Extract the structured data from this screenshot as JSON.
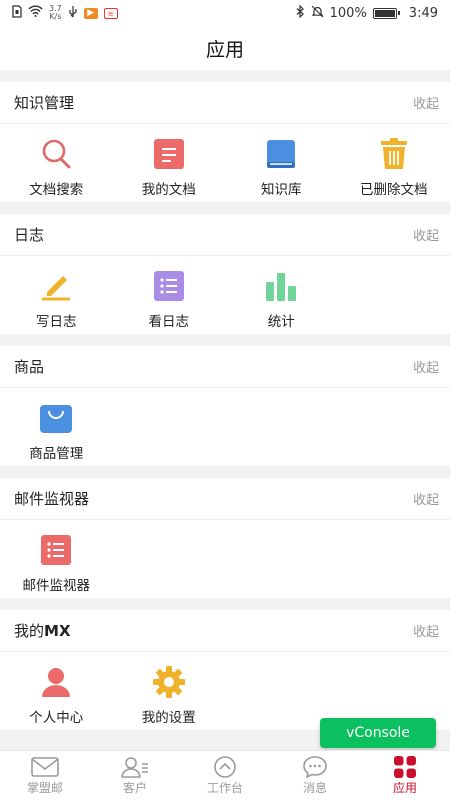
{
  "status_bar": {
    "speed": "3.7",
    "speed_unit": "K/s",
    "battery": "100%",
    "time": "3:49"
  },
  "header": {
    "title": "应用"
  },
  "sections": [
    {
      "title": "知识管理",
      "action": "收起",
      "items": [
        {
          "label": "文档搜索",
          "icon": "search-icon"
        },
        {
          "label": "我的文档",
          "icon": "document-icon"
        },
        {
          "label": "知识库",
          "icon": "book-icon"
        },
        {
          "label": "已删除文档",
          "icon": "trash-icon"
        }
      ]
    },
    {
      "title": "日志",
      "action": "收起",
      "items": [
        {
          "label": "写日志",
          "icon": "pencil-icon"
        },
        {
          "label": "看日志",
          "icon": "list-icon"
        },
        {
          "label": "统计",
          "icon": "bar-chart-icon"
        }
      ]
    },
    {
      "title": "商品",
      "action": "收起",
      "items": [
        {
          "label": "商品管理",
          "icon": "shopping-bag-icon"
        }
      ]
    },
    {
      "title": "邮件监视器",
      "action": "收起",
      "items": [
        {
          "label": "邮件监视器",
          "icon": "list-icon"
        }
      ]
    },
    {
      "title_prefix": "我的",
      "title_suffix": "MX",
      "action": "收起",
      "items": [
        {
          "label": "个人中心",
          "icon": "person-icon"
        },
        {
          "label": "我的设置",
          "icon": "gear-icon"
        }
      ]
    }
  ],
  "tabs": [
    {
      "label": "掌盟邮",
      "icon": "mail-icon"
    },
    {
      "label": "客户",
      "icon": "customer-icon"
    },
    {
      "label": "工作台",
      "icon": "dashboard-icon"
    },
    {
      "label": "消息",
      "icon": "message-icon"
    },
    {
      "label": "应用",
      "icon": "apps-icon",
      "active": true
    }
  ],
  "floating": {
    "vconsole_label": "vConsole"
  },
  "colors": {
    "accent": "#c8102e",
    "vconsole": "#0bc15f",
    "search": "#e06a6a",
    "doc": "#ec6a6a",
    "book": "#4a8fe0",
    "trash": "#f0b12b",
    "pencil": "#f0b12b",
    "list": "#a98ce6",
    "chart": "#6fd598",
    "bag": "#4a8fe0",
    "person": "#ec6a6a",
    "gear": "#f0b12b"
  }
}
